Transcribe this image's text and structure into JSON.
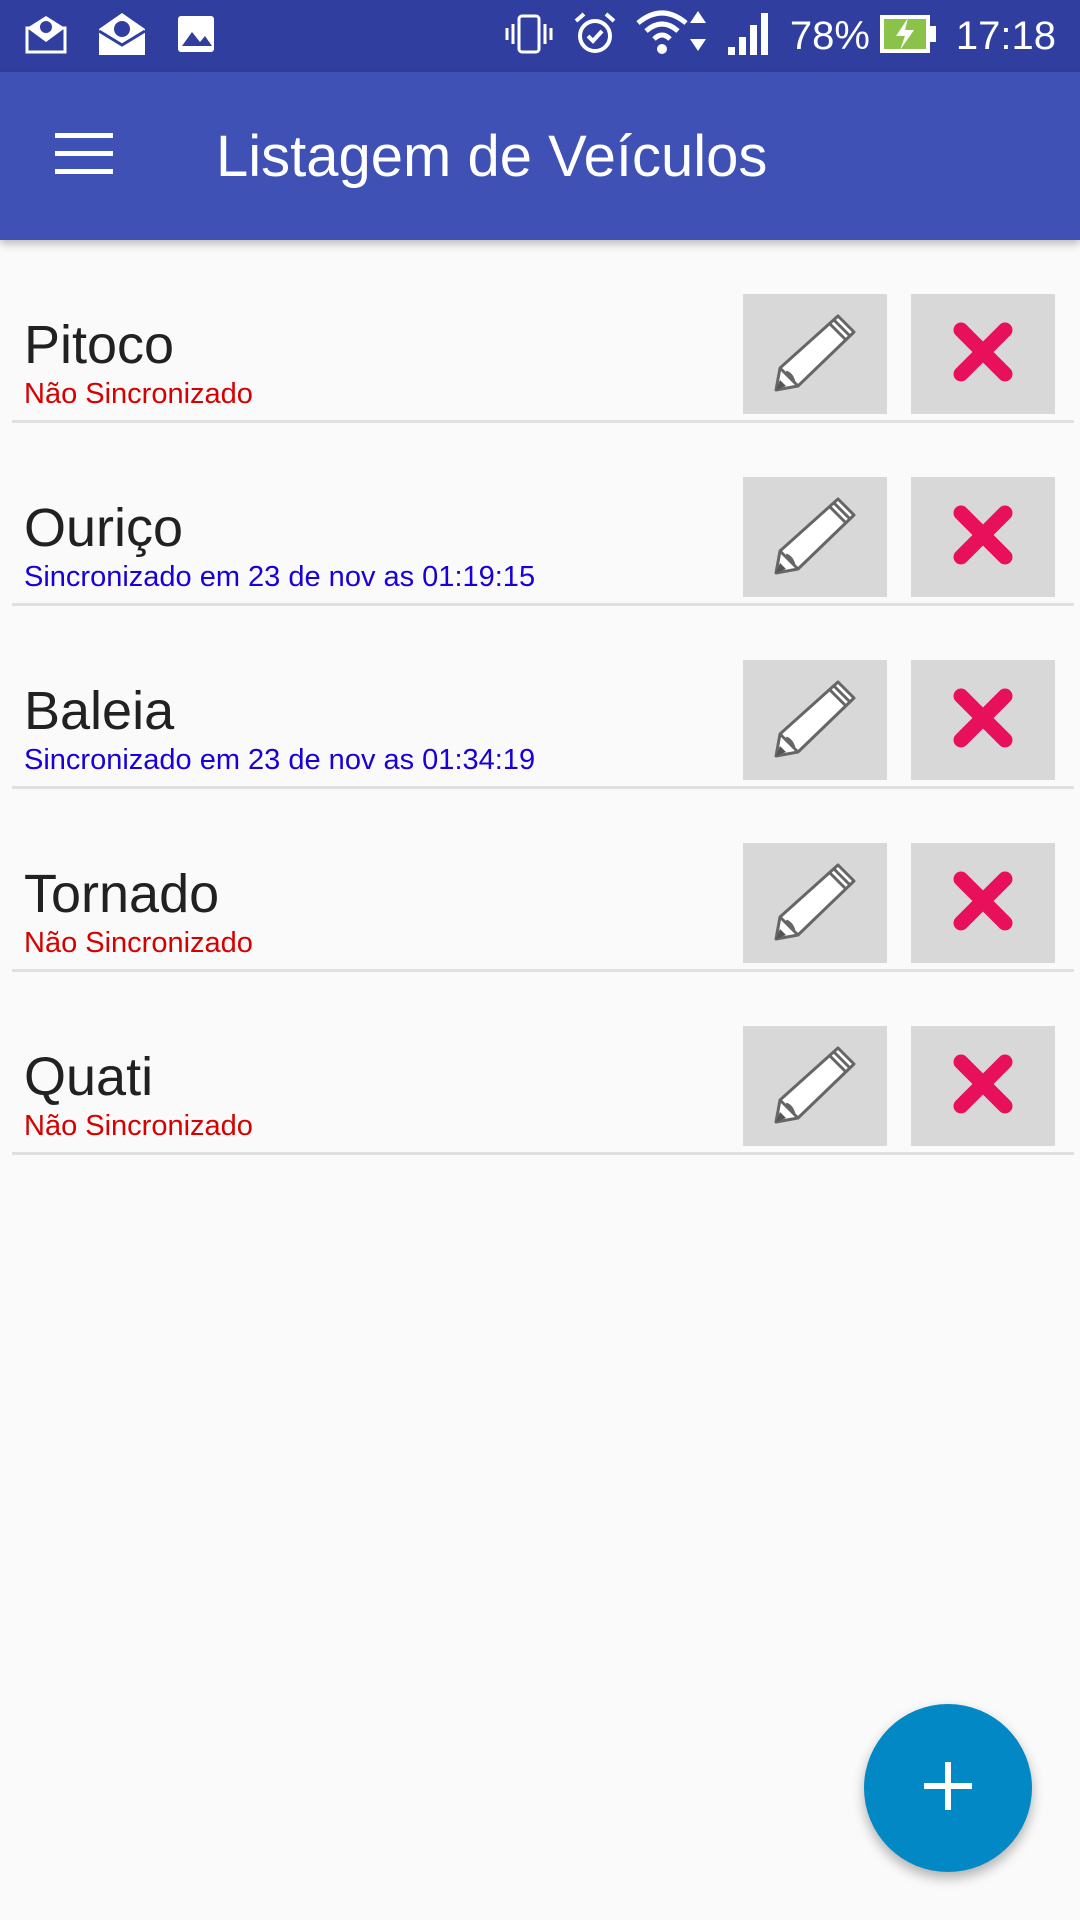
{
  "status_bar": {
    "battery": "78%",
    "time": "17:18",
    "left_icons": [
      "mail-b-icon",
      "mail-b-open-icon",
      "image-icon"
    ],
    "right_icons": [
      "vibrate-icon",
      "alarm-icon",
      "wifi-icon",
      "signal-icon",
      "battery-charging-icon"
    ]
  },
  "app_bar": {
    "title": "Listagem de Veículos",
    "menu_icon": "hamburger-menu-icon"
  },
  "colors": {
    "status_bar": "#303f9f",
    "app_bar": "#3f51b5",
    "not_synced": "#d50000",
    "synced": "#1a00d8",
    "button_bg": "#d8d8d8",
    "delete_x": "#e8105a",
    "fab": "#0288c4"
  },
  "vehicles": [
    {
      "name": "Pitoco",
      "status": "Não Sincronizado",
      "synced": false
    },
    {
      "name": "Ouriço",
      "status": "Sincronizado em 23 de nov as  01:19:15",
      "synced": true
    },
    {
      "name": "Baleia",
      "status": "Sincronizado em 23 de nov as  01:34:19",
      "synced": true
    },
    {
      "name": "Tornado",
      "status": "Não Sincronizado",
      "synced": false
    },
    {
      "name": "Quati",
      "status": "Não Sincronizado",
      "synced": false
    }
  ],
  "row_actions": {
    "edit_icon": "pencil-icon",
    "delete_icon": "close-x-icon"
  },
  "fab": {
    "icon": "plus-icon"
  }
}
